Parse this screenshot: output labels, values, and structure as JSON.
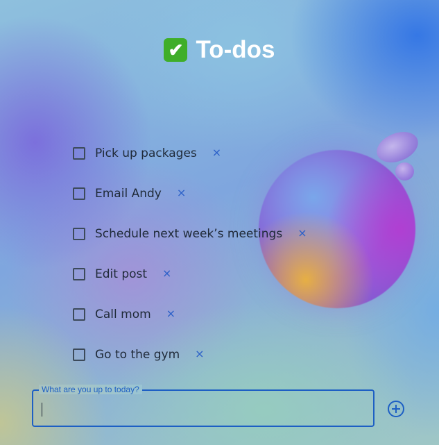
{
  "header": {
    "emoji": "✔",
    "emoji_name": "check-mark-button-icon",
    "title": "To-dos"
  },
  "todos": [
    {
      "text": "Pick up packages",
      "checked": false,
      "delete_label": "×"
    },
    {
      "text": "Email Andy",
      "checked": false,
      "delete_label": "×"
    },
    {
      "text": "Schedule next week’s meetings",
      "checked": false,
      "delete_label": "×"
    },
    {
      "text": "Edit post",
      "checked": false,
      "delete_label": "×"
    },
    {
      "text": "Call mom",
      "checked": false,
      "delete_label": "×"
    },
    {
      "text": "Go to the gym",
      "checked": false,
      "delete_label": "×"
    }
  ],
  "new_todo": {
    "label": "What are you up to today?",
    "value": ""
  },
  "add_button": {
    "icon": "plus-circle-icon"
  },
  "colors": {
    "accent": "#1d5fc4",
    "delete": "#2a5fc8",
    "text": "#1f2a38",
    "title": "#ffffff"
  }
}
